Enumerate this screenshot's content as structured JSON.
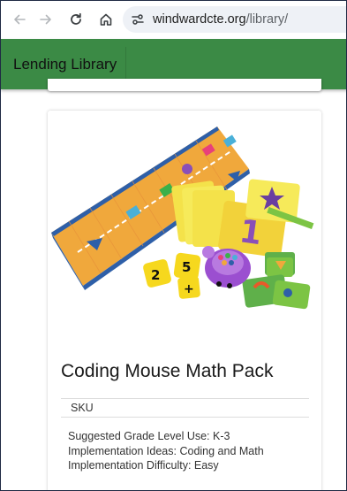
{
  "browser": {
    "url_host": "windwardcte.org",
    "url_path": "/library/",
    "icons": [
      "back-arrow-icon",
      "forward-arrow-icon",
      "reload-icon",
      "home-icon",
      "site-info-icon"
    ]
  },
  "appbar": {
    "brand": "Lending Library",
    "color": "#3b8a45"
  },
  "product": {
    "title": "Coding Mouse Math Pack",
    "sku_label": "SKU",
    "details": [
      "Suggested Grade Level Use: K-3",
      "Implementation Ideas: Coding and Math",
      "Implementation Difficulty: Easy"
    ]
  }
}
